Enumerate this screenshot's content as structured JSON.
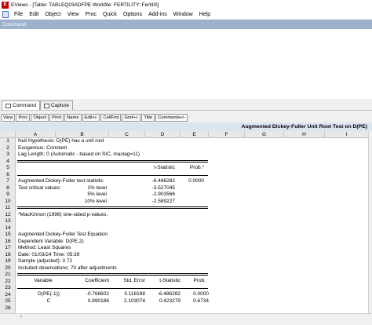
{
  "window": {
    "title": "EViews - [Table: TABLEQ03ADFPE   Workfile: FERTILITY::Fertil3\\]",
    "app_icon_label": "E"
  },
  "menu": {
    "items": [
      "File",
      "Edit",
      "Object",
      "View",
      "Proc",
      "Quick",
      "Options",
      "Add-ins",
      "Window",
      "Help"
    ]
  },
  "command": {
    "header": "Command"
  },
  "tabs": [
    {
      "label": "Command"
    },
    {
      "label": "Capture"
    }
  ],
  "toolbar": {
    "buttons": [
      "View",
      "Proc",
      "Object",
      "Print",
      "Name",
      "Edit+/-",
      "CellFmt",
      "Grid+/-",
      "Title",
      "Comments+/-"
    ]
  },
  "sheet": {
    "title": "Augmented Dickey-Fuller Unit Root Test on D(PE)",
    "columns": [
      "A",
      "B",
      "C",
      "D",
      "E",
      "F",
      "G",
      "H",
      "I"
    ],
    "rows": [
      "1",
      "2",
      "3",
      "4",
      "5",
      "6",
      "7",
      "8",
      "9",
      "10",
      "11",
      "12",
      "13",
      "14",
      "15",
      "16",
      "17",
      "18",
      "19",
      "20",
      "21",
      "22",
      "23",
      "24",
      "25",
      "26"
    ],
    "text": {
      "r1": "Null Hypothesis: D(PE) has a unit root",
      "r2": "Exogenous: Constant",
      "r3": "Lag Length: 0 (Automatic - based on SIC, maxlag=11)",
      "r5_tstat": "t-Statistic",
      "r5_prob": "Prob.*",
      "r7_label": "Augmented Dickey-Fuller test statistic",
      "r7_tstat": "-6.486282",
      "r7_prob": "0.0000",
      "r8_label": "Test critical values:",
      "r8_level": "1% level",
      "r8_val": "-3.527045",
      "r9_level": "5% level",
      "r9_val": "-2.903566",
      "r10_level": "10% level",
      "r10_val": "-2.589227",
      "r12": "*MacKinnon (1996) one-sided p-values.",
      "r15": "Augmented Dickey-Fuller Test Equation",
      "r16": "Dependent Variable: D(PE,2)",
      "r17": "Method: Least Squares",
      "r18": "Date: 01/03/24   Time: 05:39",
      "r19": "Sample (adjusted): 3 72",
      "r20": "Included observations: 70 after adjustments",
      "r22_var": "Variable",
      "r22_coef": "Coefficient",
      "r22_se": "Std. Error",
      "r22_t": "t-Statistic",
      "r22_prob": "Prob.",
      "r24_var": "D(PE(-1))",
      "r24_coef": "-0.766602",
      "r24_se": "0.118188",
      "r24_t": "-6.486282",
      "r24_prob": "0.0000",
      "r25_var": "C",
      "r25_coef": "0.890186",
      "r25_se": "2.103074",
      "r25_t": "0.423279",
      "r25_prob": "0.6734"
    }
  },
  "scrollbar": {
    "left_arrow": "‹"
  }
}
